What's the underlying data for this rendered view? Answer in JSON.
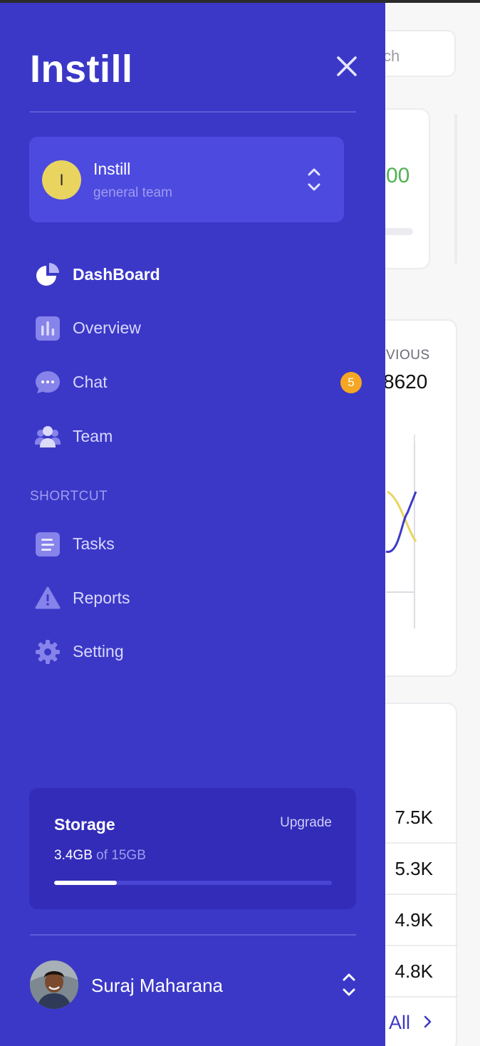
{
  "background": {
    "search_placeholder": "ch",
    "card1_value": "00",
    "card2_label": "VIOUS",
    "card2_number": "8620",
    "stats": [
      "7.5K",
      "5.3K",
      "4.9K",
      "4.8K"
    ],
    "view_all": "All"
  },
  "sidebar": {
    "logo": "Instill",
    "team": {
      "initial": "I",
      "name": "Instill",
      "subtitle": "general team"
    },
    "nav": [
      {
        "label": "DashBoard",
        "icon": "pie-chart-icon",
        "active": true
      },
      {
        "label": "Overview",
        "icon": "bar-chart-icon"
      },
      {
        "label": "Chat",
        "icon": "chat-bubble-icon",
        "badge": "5"
      },
      {
        "label": "Team",
        "icon": "people-icon"
      }
    ],
    "section_label": "SHORTCUT",
    "shortcuts": [
      {
        "label": "Tasks",
        "icon": "list-icon"
      },
      {
        "label": "Reports",
        "icon": "warning-icon"
      },
      {
        "label": "Setting",
        "icon": "gear-icon"
      }
    ],
    "storage": {
      "title": "Storage",
      "upgrade": "Upgrade",
      "used": "3.4GB",
      "total_text": "of 15GB",
      "used_fraction": 0.2267
    },
    "user": {
      "name": "Suraj Maharana"
    }
  },
  "colors": {
    "sidebar_bg": "#3b38c8",
    "accent": "#4d4ae0",
    "badge": "#f5a623",
    "avatar_team": "#e9d460"
  }
}
